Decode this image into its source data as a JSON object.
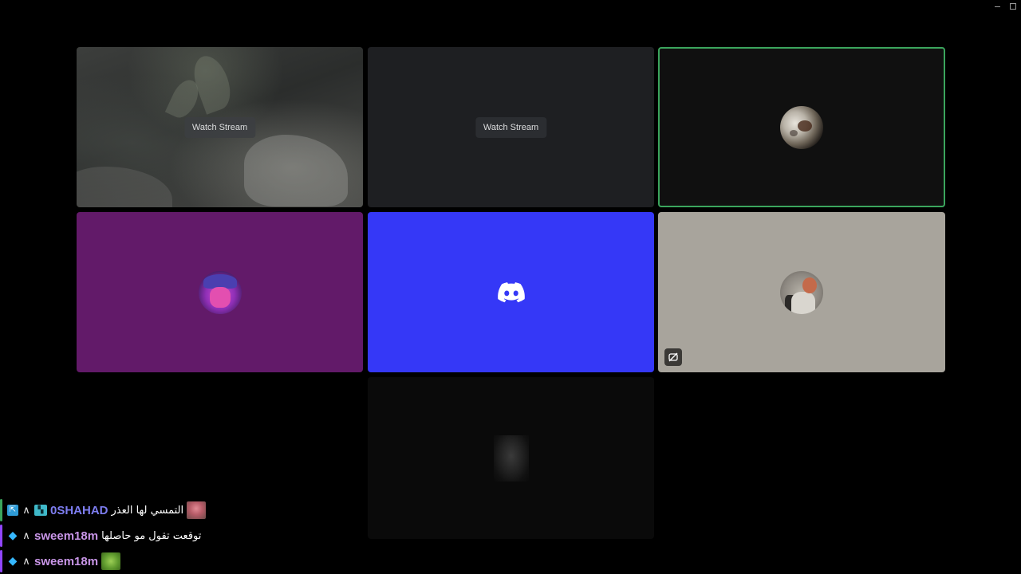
{
  "window": {
    "controls": {
      "minimize": "minimize-icon",
      "maximize": "maximize-icon"
    }
  },
  "tiles": [
    {
      "kind": "stream",
      "button_label": "Watch Stream"
    },
    {
      "kind": "stream",
      "button_label": "Watch Stream"
    },
    {
      "kind": "avatar",
      "avatar": "moon-avatar",
      "speaking": true,
      "speaking_color": "#3ba55d"
    },
    {
      "kind": "avatar",
      "avatar": "hat-avatar",
      "background": "#621a69"
    },
    {
      "kind": "logo",
      "icon": "discord-icon",
      "background": "#3538f7"
    },
    {
      "kind": "avatar",
      "avatar": "person-avatar",
      "background": "#a8a49c",
      "badge_icon": "camera-off-icon"
    },
    {
      "kind": "avatar",
      "avatar": "dark-portrait-avatar",
      "background": "#0a0a0a"
    }
  ],
  "chat": {
    "messages": [
      {
        "badges": [
          "prime-icon",
          "arrow-icon",
          "gift-icon"
        ],
        "username": "0SHAHAD",
        "username_color": "#7d7df0",
        "text": "التمسي لها العذر",
        "emote": "pink-emote"
      },
      {
        "badges": [
          "cube-icon",
          "arrow-icon"
        ],
        "username": "sweem18m",
        "username_color": "#c996e8",
        "text": "توقعت تقول مو حاصلها",
        "emote": ""
      },
      {
        "badges": [
          "cube-icon",
          "arrow-icon"
        ],
        "username": "sweem18m",
        "username_color": "#c996e8",
        "text": "",
        "emote": "green-emote"
      }
    ]
  }
}
